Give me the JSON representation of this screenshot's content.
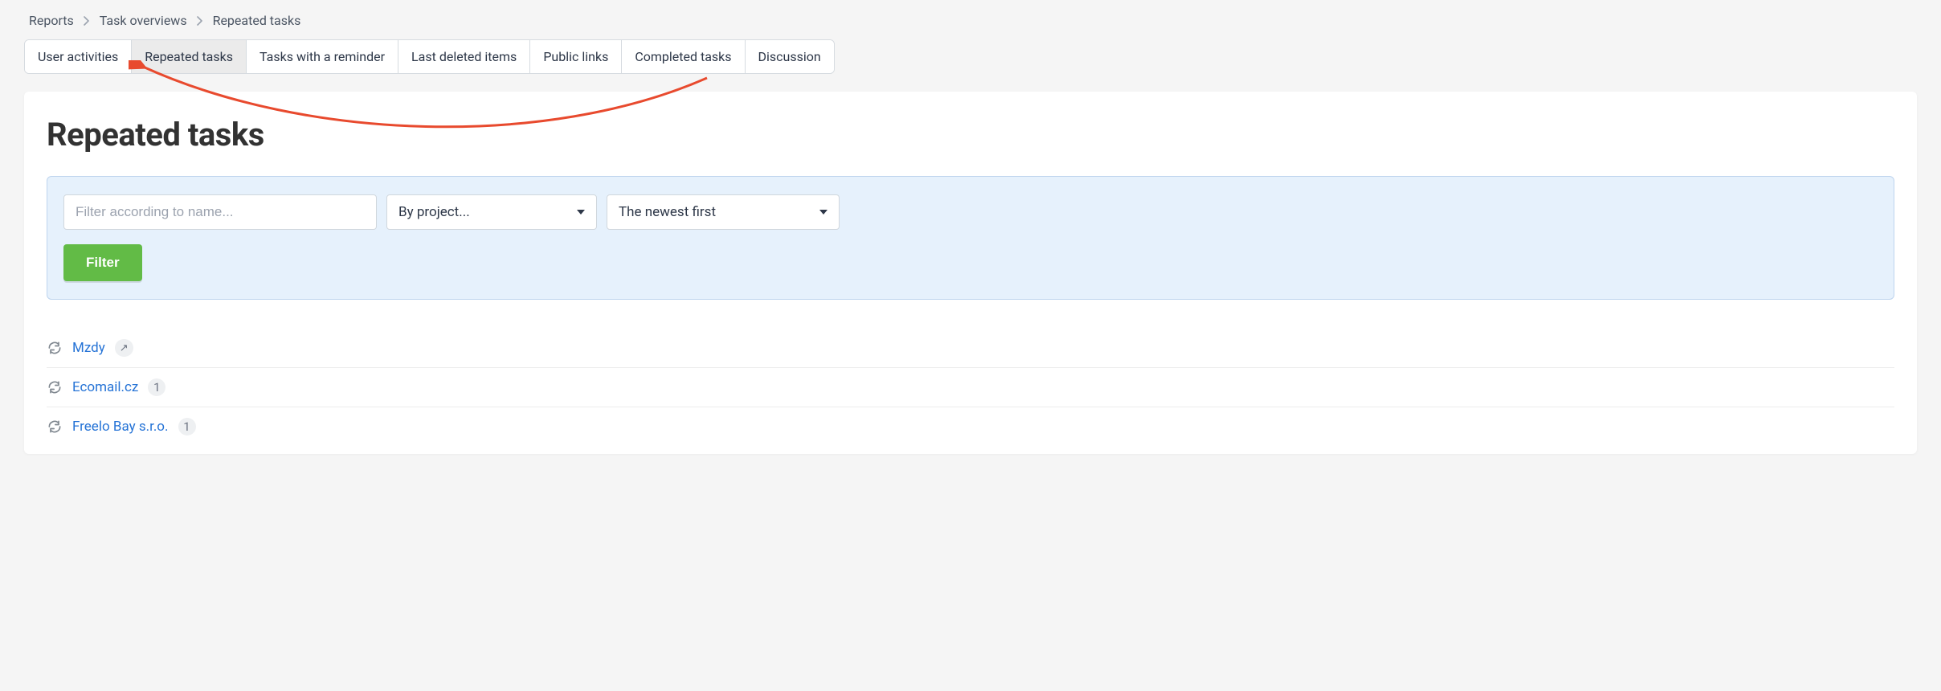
{
  "breadcrumb": {
    "items": [
      "Reports",
      "Task overviews",
      "Repeated tasks"
    ]
  },
  "tabs": {
    "items": [
      {
        "label": "User activities",
        "active": false
      },
      {
        "label": "Repeated tasks",
        "active": true
      },
      {
        "label": "Tasks with a reminder",
        "active": false
      },
      {
        "label": "Last deleted items",
        "active": false
      },
      {
        "label": "Public links",
        "active": false
      },
      {
        "label": "Completed tasks",
        "active": false
      },
      {
        "label": "Discussion",
        "active": false
      }
    ]
  },
  "page": {
    "title": "Repeated tasks"
  },
  "filter": {
    "name_placeholder": "Filter according to name...",
    "project_select": "By project...",
    "sort_select": "The newest first",
    "button": "Filter"
  },
  "list": {
    "items": [
      {
        "name": "Mzdy",
        "badge_type": "arrow",
        "badge": "↗"
      },
      {
        "name": "Ecomail.cz",
        "badge_type": "count",
        "badge": "1"
      },
      {
        "name": "Freelo Bay s.r.o.",
        "badge_type": "count",
        "badge": "1"
      }
    ]
  }
}
